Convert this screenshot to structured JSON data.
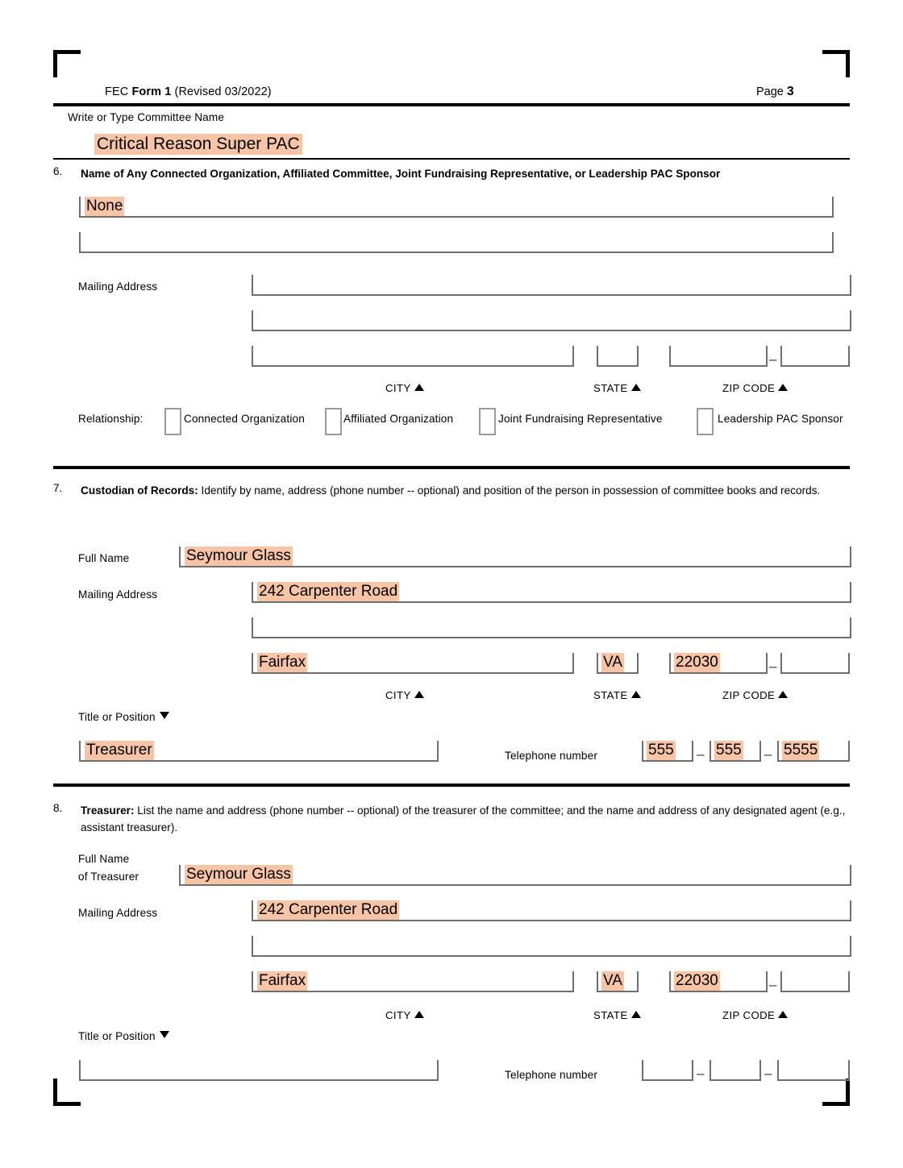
{
  "header": {
    "agency": "FEC",
    "form_name": "Form 1",
    "revision": "(Revised 03/2022)",
    "page_label": "Page",
    "page_number": "3"
  },
  "committee": {
    "instruction": "Write or Type Committee Name",
    "name": "Critical Reason Super PAC"
  },
  "section6": {
    "number": "6.",
    "title": "Name of Any Connected Organization, Affiliated Committee, Joint Fundraising Representative, or Leadership PAC Sponsor",
    "name_line1": "None",
    "name_line2": "",
    "mailing_address_label": "Mailing Address",
    "address_line1": "",
    "address_line2": "",
    "city": "",
    "state": "",
    "zip5": "",
    "zip4": "",
    "city_label": "CITY",
    "state_label": "STATE",
    "zip_label": "ZIP CODE",
    "relationship_label": "Relationship:",
    "relationship_options": [
      {
        "label": "Connected Organization",
        "checked": false
      },
      {
        "label": "Affiliated Organization",
        "checked": false
      },
      {
        "label": "Joint Fundraising Representative",
        "checked": false
      },
      {
        "label": "Leadership PAC Sponsor",
        "checked": false
      }
    ]
  },
  "section7": {
    "number": "7.",
    "title": "Custodian of Records:",
    "description": " Identify by name, address (phone number -- optional) and position of the person in possession of committee books and records.",
    "full_name_label": "Full Name",
    "full_name": "Seymour Glass",
    "mailing_address_label": "Mailing Address",
    "address_line1": "242 Carpenter Road",
    "address_line2": "",
    "city": "Fairfax",
    "state": "VA",
    "zip5": "22030",
    "zip4": "",
    "city_label": "CITY",
    "state_label": "STATE",
    "zip_label": "ZIP CODE",
    "title_position_label": "Title or Position",
    "title_position": "Treasurer",
    "telephone_label": "Telephone number",
    "phone_area": "555",
    "phone_prefix": "555",
    "phone_line": "5555"
  },
  "section8": {
    "number": "8.",
    "title": "Treasurer:",
    "description": " List the name and address (phone number -- optional) of the treasurer of the committee; and the name and address of any designated agent (e.g., assistant treasurer).",
    "full_name_label_line1": "Full Name",
    "full_name_label_line2": "of Treasurer",
    "full_name": "Seymour Glass",
    "mailing_address_label": "Mailing Address",
    "address_line1": "242 Carpenter Road",
    "address_line2": "",
    "city": "Fairfax",
    "state": "VA",
    "zip5": "22030",
    "zip4": "",
    "city_label": "CITY",
    "state_label": "STATE",
    "zip_label": "ZIP CODE",
    "title_position_label": "Title or Position",
    "title_position": "",
    "telephone_label": "Telephone number",
    "phone_area": "",
    "phone_prefix": "",
    "phone_line": ""
  },
  "colors": {
    "highlight": "#f7c4a6",
    "field_line": "#6e6e6e",
    "rule": "#000000"
  }
}
